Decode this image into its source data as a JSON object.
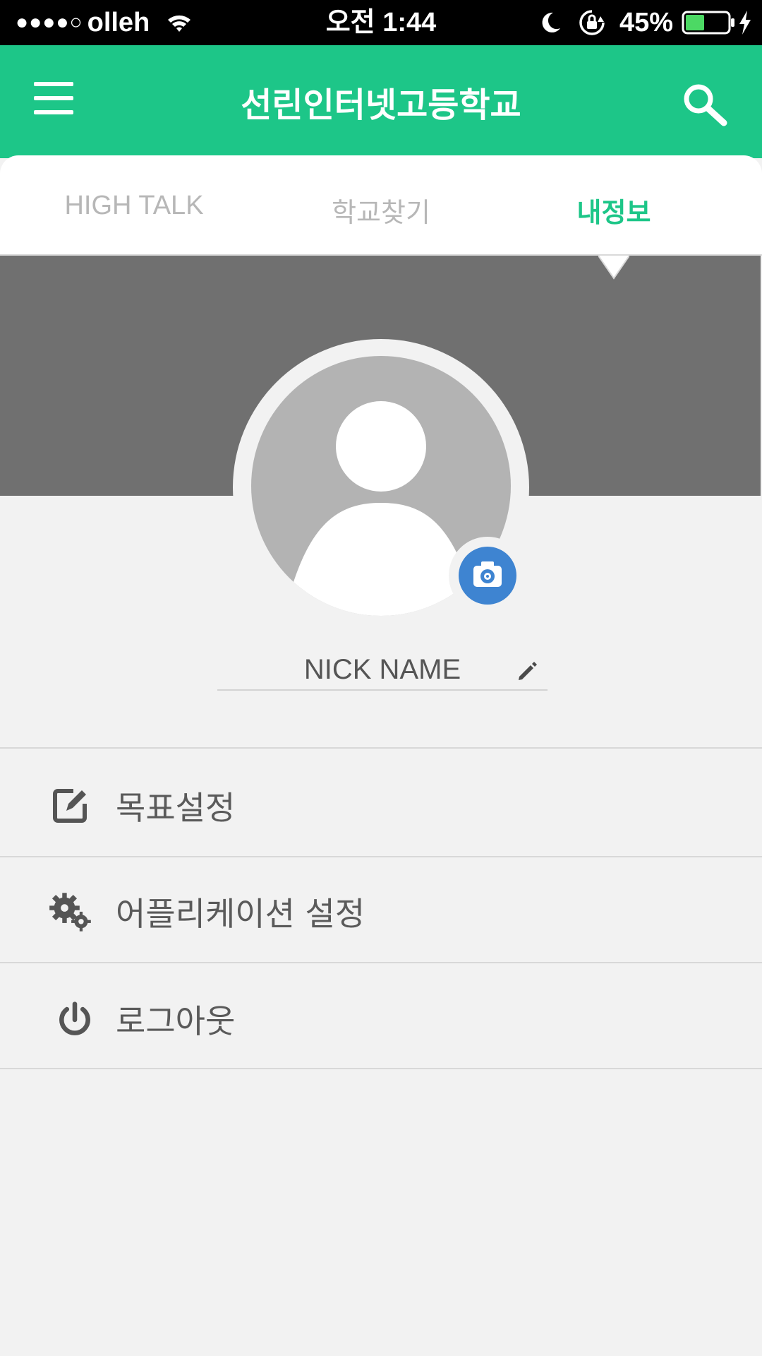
{
  "status_bar": {
    "signal": "●●●●○",
    "carrier": "olleh",
    "time": "오전 1:44",
    "battery_percent": "45%",
    "battery_level": 0.45,
    "icons": [
      "wifi-icon",
      "moon-icon",
      "rotation-lock-icon",
      "battery-icon",
      "charging-bolt-icon"
    ]
  },
  "header": {
    "title": "선린인터넷고등학교",
    "icons": [
      "hamburger-menu-icon",
      "search-icon"
    ],
    "color": "#1dc688"
  },
  "tabs": [
    {
      "label": "HIGH TALK",
      "active": false
    },
    {
      "label": "학교찾기",
      "active": false
    },
    {
      "label": "내정보",
      "active": true
    }
  ],
  "profile": {
    "nickname": "NICK NAME",
    "icons": [
      "default-avatar-icon",
      "camera-icon",
      "pencil-icon"
    ],
    "camera_color": "#3e84d1"
  },
  "menu": [
    {
      "label": "목표설정",
      "icon": "edit-square-icon"
    },
    {
      "label": "어플리케이션 설정",
      "icon": "gears-icon"
    },
    {
      "label": "로그아웃",
      "icon": "power-icon"
    }
  ],
  "colors": {
    "accent": "#1dc688",
    "cover": "#707070",
    "background": "#f2f2f2"
  }
}
